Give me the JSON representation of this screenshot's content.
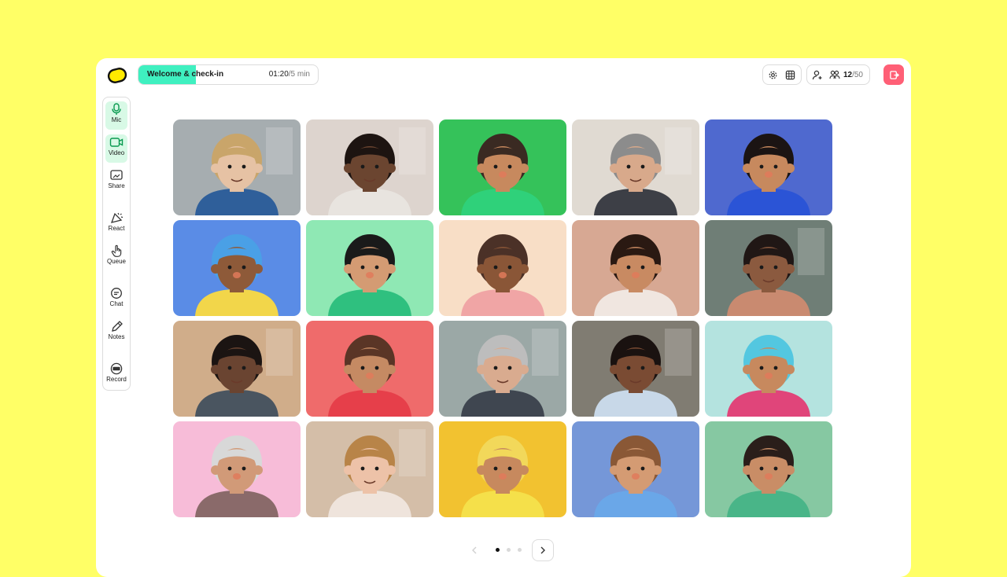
{
  "agenda": {
    "title": "Welcome & check-in",
    "elapsed": "01:20",
    "total": "/5 min",
    "progress": 0.32
  },
  "participants": {
    "current": "12",
    "max": "/50"
  },
  "colors": {
    "background": "#ffff66",
    "accent": "#3ff0c0",
    "active_bg": "#d8f9e6",
    "leave": "#ff5f76"
  },
  "sidebar": {
    "items": [
      {
        "label": "Mic",
        "icon": "mic-icon",
        "active": true
      },
      {
        "label": "Video",
        "icon": "video-icon",
        "active": true
      },
      {
        "label": "Share",
        "icon": "share-screen-icon",
        "active": false
      },
      {
        "label": "React",
        "icon": "react-icon",
        "active": false
      },
      {
        "label": "Queue",
        "icon": "raise-hand-icon",
        "active": false
      },
      {
        "label": "Chat",
        "icon": "chat-icon",
        "active": false
      },
      {
        "label": "Notes",
        "icon": "pencil-icon",
        "active": false
      },
      {
        "label": "Record",
        "icon": "rec-icon",
        "active": false
      }
    ]
  },
  "toolbar_icons": [
    "gear-icon",
    "grid-icon",
    "add-person-icon",
    "people-icon",
    "leave-icon"
  ],
  "grid": {
    "tiles": [
      {
        "kind": "photo",
        "bg": "#9aa2a6",
        "skin": "#e6c2a4",
        "hair": "#c9a56a",
        "shirt": "#2f5f9a"
      },
      {
        "kind": "photo",
        "bg": "#d9cfc8",
        "skin": "#6b4530",
        "hair": "#1d1411",
        "shirt": "#e8e4df"
      },
      {
        "kind": "avatar",
        "bg": "#35c25a",
        "skin": "#c7895e",
        "hair": "#3a2a22",
        "shirt": "#2fd17a"
      },
      {
        "kind": "photo",
        "bg": "#dcd5cc",
        "skin": "#d8a98b",
        "hair": "#8c8c8c",
        "shirt": "#3d3f46"
      },
      {
        "kind": "avatar",
        "bg": "#4f69cf",
        "skin": "#c7895e",
        "hair": "#1b1413",
        "shirt": "#2b54d6"
      },
      {
        "kind": "avatar",
        "bg": "#5a8ce6",
        "skin": "#8e5a39",
        "hair": "#4aa0e6",
        "shirt": "#f2d64a"
      },
      {
        "kind": "avatar",
        "bg": "#8fe8b4",
        "skin": "#d49b73",
        "hair": "#1a1a1a",
        "shirt": "#2fc07f"
      },
      {
        "kind": "avatar",
        "bg": "#f8dec6",
        "skin": "#8a5637",
        "hair": "#4b3127",
        "shirt": "#f0a5a5"
      },
      {
        "kind": "avatar",
        "bg": "#d7a893",
        "skin": "#c88a62",
        "hair": "#2a1912",
        "shirt": "#f0e6e0"
      },
      {
        "kind": "photo",
        "bg": "#5c6d64",
        "skin": "#8b5a3f",
        "hair": "#201715",
        "shirt": "#c98a70"
      },
      {
        "kind": "photo",
        "bg": "#caa27a",
        "skin": "#6a4431",
        "hair": "#1b1412",
        "shirt": "#4a5560"
      },
      {
        "kind": "avatar",
        "bg": "#ef6b6b",
        "skin": "#c58a63",
        "hair": "#5a3526",
        "shirt": "#e63f4a"
      },
      {
        "kind": "photo",
        "bg": "#8e9c9a",
        "skin": "#d9ab8f",
        "hair": "#bdbdbd",
        "shirt": "#3f4650"
      },
      {
        "kind": "photo",
        "bg": "#6f6a5f",
        "skin": "#7a4b33",
        "hair": "#1a1210",
        "shirt": "#c8d8e8"
      },
      {
        "kind": "avatar",
        "bg": "#b4e3df",
        "skin": "#c7895e",
        "hair": "#53c7e0",
        "shirt": "#e0457a"
      },
      {
        "kind": "avatar",
        "bg": "#f7bcd8",
        "skin": "#d19a78",
        "hair": "#d8d8d8",
        "shirt": "#8a6a6a"
      },
      {
        "kind": "photo",
        "bg": "#cfb59c",
        "skin": "#edc2a8",
        "hair": "#b88448",
        "shirt": "#efe4dc"
      },
      {
        "kind": "avatar",
        "bg": "#f2c230",
        "skin": "#c7895e",
        "hair": "#f2d85a",
        "shirt": "#f5e04a"
      },
      {
        "kind": "avatar",
        "bg": "#7597d8",
        "skin": "#d49b73",
        "hair": "#8a5836",
        "shirt": "#6aa7e8"
      },
      {
        "kind": "avatar",
        "bg": "#86c8a2",
        "skin": "#c98d66",
        "hair": "#2a1e1a",
        "shirt": "#49b588"
      }
    ]
  },
  "pagination": {
    "pages": 3,
    "current": 1
  }
}
